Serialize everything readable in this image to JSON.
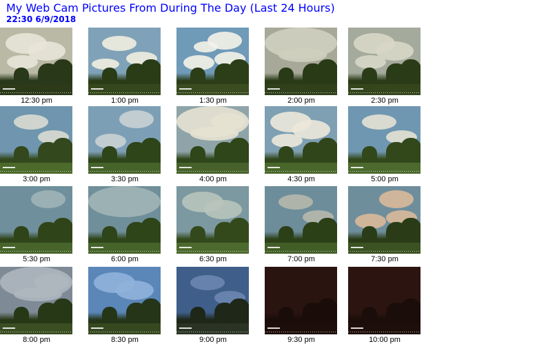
{
  "page": {
    "title": "My Web Cam Pictures From During The Day (Last 24 Hours)",
    "timestamp": "22:30  6/9/2018"
  },
  "gallery": [
    {
      "time": "12:30 pm",
      "sky": "#b9b9a6",
      "cloud": "#e8e6d8",
      "ground": "#2c3a1a",
      "tree": "#283818",
      "clouds": 3
    },
    {
      "time": "1:00 pm",
      "sky": "#7fa2b8",
      "cloud": "#f1ede0",
      "ground": "#35481d",
      "tree": "#2a3c16",
      "clouds": 3
    },
    {
      "time": "1:30 pm",
      "sky": "#6f9ab8",
      "cloud": "#f4f2e8",
      "ground": "#3a4c20",
      "tree": "#2c3e18",
      "clouds": 4
    },
    {
      "time": "2:00 pm",
      "sky": "#a7a898",
      "cloud": "#cfcfbf",
      "ground": "#2f401b",
      "tree": "#283a16",
      "clouds": 2
    },
    {
      "time": "2:30 pm",
      "sky": "#a4aa9c",
      "cloud": "#d8d7c8",
      "ground": "#35461d",
      "tree": "#2a3b17",
      "clouds": 3
    },
    {
      "time": "3:00 pm",
      "sky": "#6f96ae",
      "cloud": "#d9dbd2",
      "ground": "#4c6a2a",
      "tree": "#33481c",
      "clouds": 2
    },
    {
      "time": "3:30 pm",
      "sky": "#7d9fb6",
      "cloud": "#c9d2d4",
      "ground": "#46632a",
      "tree": "#2e4419",
      "clouds": 2
    },
    {
      "time": "4:00 pm",
      "sky": "#8ea4a8",
      "cloud": "#e6e2d2",
      "ground": "#46622a",
      "tree": "#2f451a",
      "clouds": 3
    },
    {
      "time": "4:30 pm",
      "sky": "#7f9fb2",
      "cloud": "#ece8da",
      "ground": "#4a672b",
      "tree": "#30461a",
      "clouds": 3
    },
    {
      "time": "5:00 pm",
      "sky": "#6f97b1",
      "cloud": "#e4e2d4",
      "ground": "#4c6a2d",
      "tree": "#32481b",
      "clouds": 2
    },
    {
      "time": "5:30 pm",
      "sky": "#6f8f9c",
      "cloud": "#9fb4b8",
      "ground": "#47652a",
      "tree": "#2f4519",
      "clouds": 1
    },
    {
      "time": "6:00 pm",
      "sky": "#6f8f9a",
      "cloud": "#a1b5b7",
      "ground": "#46632a",
      "tree": "#2e4419",
      "clouds": 1
    },
    {
      "time": "6:30 pm",
      "sky": "#7c98a0",
      "cloud": "#b8c4bd",
      "ground": "#4d6a2e",
      "tree": "#33491c",
      "clouds": 2
    },
    {
      "time": "7:00 pm",
      "sky": "#6d8d9a",
      "cloud": "#b6b8ad",
      "ground": "#425e27",
      "tree": "#2c4018",
      "clouds": 2
    },
    {
      "time": "7:30 pm",
      "sky": "#6f8e9c",
      "cloud": "#d9b99a",
      "ground": "#3b5222",
      "tree": "#2a3c17",
      "clouds": 3
    },
    {
      "time": "8:00 pm",
      "sky": "#7e8b96",
      "cloud": "#aeb6bf",
      "ground": "#3a4e22",
      "tree": "#273817",
      "clouds": 3
    },
    {
      "time": "8:30 pm",
      "sky": "#5b86b8",
      "cloud": "#8fb2da",
      "ground": "#35481f",
      "tree": "#253518",
      "clouds": 2
    },
    {
      "time": "9:00 pm",
      "sky": "#3f5f8a",
      "cloud": "#6b87b0",
      "ground": "#2a3424",
      "tree": "#1e2718",
      "clouds": 2
    },
    {
      "time": "9:30 pm",
      "sky": "#2a1410",
      "cloud": "#2f1a14",
      "ground": "#1e0e0a",
      "tree": "#1a0c08",
      "clouds": 0
    },
    {
      "time": "10:00 pm",
      "sky": "#2c1510",
      "cloud": "#311b14",
      "ground": "#1f0f0b",
      "tree": "#1b0d09",
      "clouds": 0
    }
  ]
}
